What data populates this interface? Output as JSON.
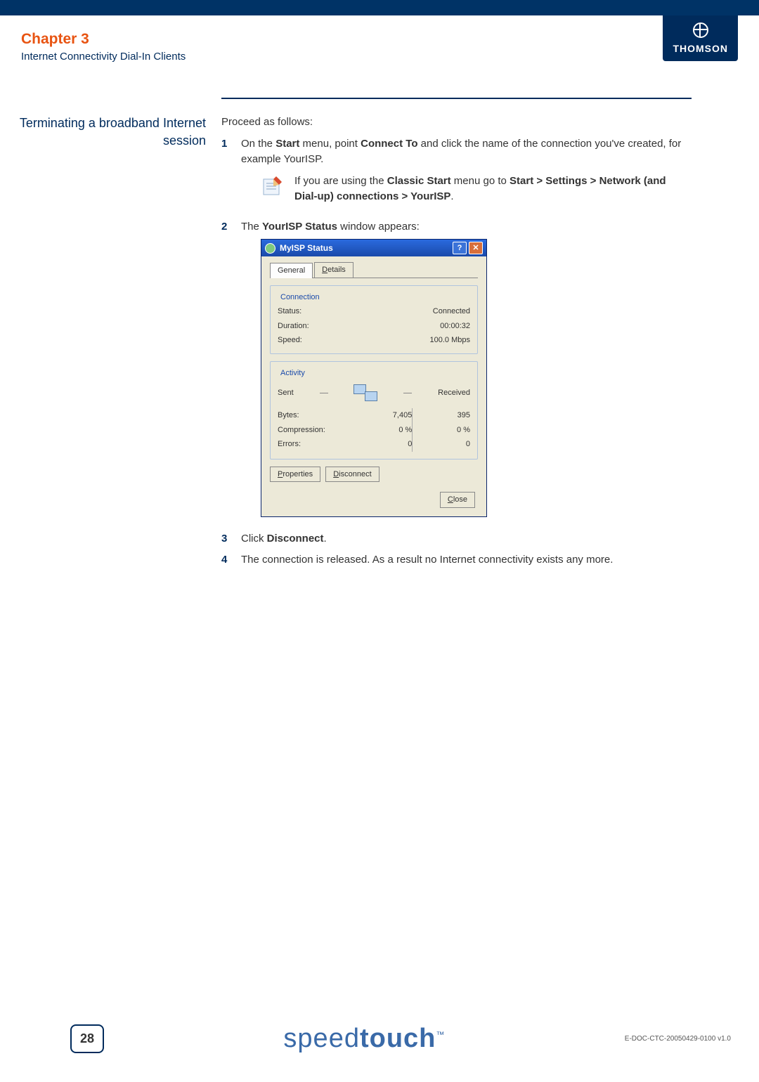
{
  "header": {
    "chapter": "Chapter 3",
    "subtitle": "Internet Connectivity Dial-In Clients",
    "brand": "THOMSON"
  },
  "sidehead": "Terminating a broadband Internet session",
  "intro": "Proceed as follows:",
  "steps": {
    "s1_pre": "On the ",
    "s1_start": "Start",
    "s1_mid1": " menu, point ",
    "s1_connect": "Connect To",
    "s1_mid2": " and click the name of the connection you've created, for example YourISP.",
    "note_pre": "If you are using the ",
    "note_classic": "Classic Start",
    "note_mid": " menu go to ",
    "note_path": "Start > Settings > Network (and Dial-up) connections > YourISP",
    "note_post": ".",
    "s2_pre": "The ",
    "s2_status": "YourISP Status",
    "s2_post": " window appears:",
    "s3_pre": "Click ",
    "s3_disc": "Disconnect",
    "s3_post": ".",
    "s4": "The connection is released. As a result no Internet connectivity exists any more."
  },
  "dialog": {
    "title": "MyISP Status",
    "tab_general": "General",
    "tab_details": "Details",
    "group_connection": "Connection",
    "lbl_status": "Status:",
    "val_status": "Connected",
    "lbl_duration": "Duration:",
    "val_duration": "00:00:32",
    "lbl_speed": "Speed:",
    "val_speed": "100.0 Mbps",
    "group_activity": "Activity",
    "lbl_sent": "Sent",
    "lbl_received": "Received",
    "lbl_bytes": "Bytes:",
    "val_bytes_sent": "7,405",
    "val_bytes_recv": "395",
    "lbl_compression": "Compression:",
    "val_comp_sent": "0 %",
    "val_comp_recv": "0 %",
    "lbl_errors": "Errors:",
    "val_err_sent": "0",
    "val_err_recv": "0",
    "btn_properties": "Properties",
    "btn_disconnect": "Disconnect",
    "btn_close": "Close",
    "btn_help": "?",
    "btn_x": "✕"
  },
  "footer": {
    "page": "28",
    "product_a": "speed",
    "product_b": "touch",
    "tm": "™",
    "docref": "E-DOC-CTC-20050429-0100 v1.0"
  }
}
